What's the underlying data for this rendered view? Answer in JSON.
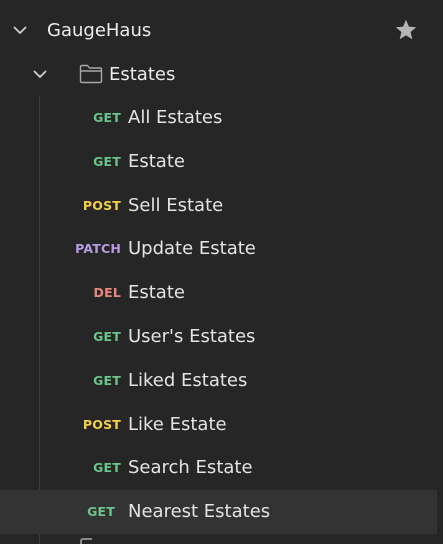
{
  "collection": {
    "name": "GaugeHaus",
    "star_color": "#b5b5b5"
  },
  "folder": {
    "name": "Estates"
  },
  "method_colors": {
    "GET": "#6bc489",
    "POST": "#f2d04b",
    "PATCH": "#b79ae2",
    "DEL": "#e8887a"
  },
  "requests": [
    {
      "method": "GET",
      "name": "All Estates"
    },
    {
      "method": "GET",
      "name": "Estate"
    },
    {
      "method": "POST",
      "name": "Sell Estate"
    },
    {
      "method": "PATCH",
      "name": "Update Estate"
    },
    {
      "method": "DEL",
      "name": "Estate"
    },
    {
      "method": "GET",
      "name": "User's Estates"
    },
    {
      "method": "GET",
      "name": "Liked Estates"
    },
    {
      "method": "POST",
      "name": "Like Estate"
    },
    {
      "method": "GET",
      "name": "Search Estate"
    },
    {
      "method": "GET",
      "name": "Nearest Estates",
      "active": true
    }
  ]
}
